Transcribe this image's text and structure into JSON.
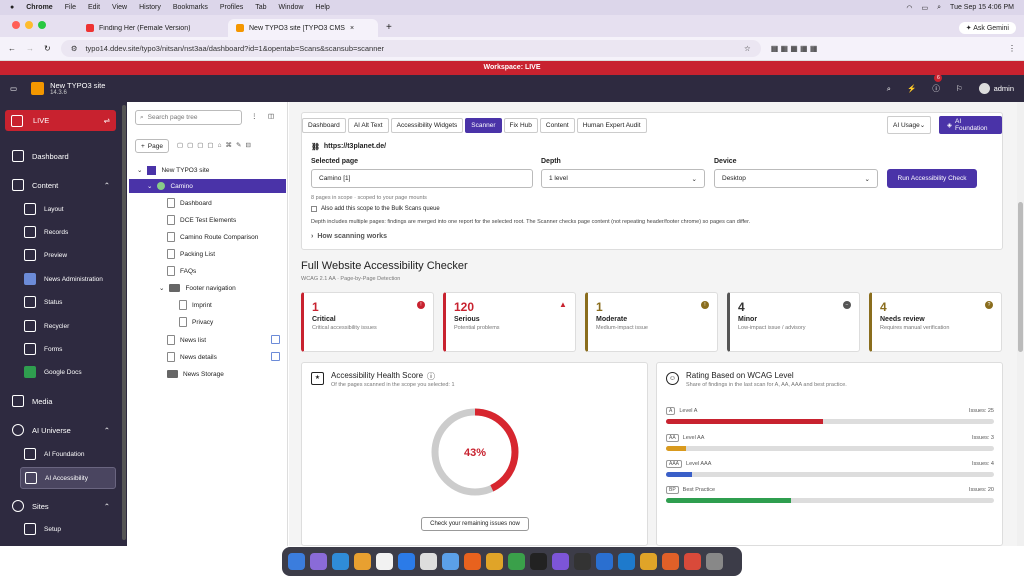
{
  "mac": {
    "app": "Chrome",
    "menus": [
      "File",
      "Edit",
      "View",
      "History",
      "Bookmarks",
      "Profiles",
      "Tab",
      "Window",
      "Help"
    ],
    "clock": "Tue Sep 15  4:06 PM"
  },
  "browser": {
    "tabs": [
      "Finding Her (Female Version)",
      "New TYPO3 site [TYPO3 CMS"
    ],
    "url": "typo14.ddev.site/typo3/nitsan/nst3aa/dashboard?id=1&opentab=Scans&scansub=scanner",
    "ask": "Ask Gemini"
  },
  "workspace": "Workspace: LIVE",
  "site": {
    "name": "New TYPO3 site",
    "version": "14.3.6",
    "user": "admin",
    "badge": "6"
  },
  "sidebar": {
    "live": "LIVE",
    "items": [
      "Dashboard",
      "Content",
      "Layout",
      "Records",
      "Preview",
      "News Administration",
      "Status",
      "Recycler",
      "Forms",
      "Google Docs",
      "Media",
      "AI Universe",
      "AI Foundation",
      "AI Accessibility",
      "Sites",
      "Setup"
    ]
  },
  "tree": {
    "search": "Search page tree",
    "new_page": "Page",
    "nodes": [
      "New TYPO3 site",
      "Camino",
      "Dashboard",
      "DCE Test Elements",
      "Camino Route Comparison",
      "Packing List",
      "FAQs",
      "Footer navigation",
      "Imprint",
      "Privacy",
      "News list",
      "News details",
      "News Storage"
    ]
  },
  "tabs": [
    "Dashboard",
    "AI Alt Text",
    "Accessibility Widgets",
    "Scanner",
    "Fix Hub",
    "Content",
    "Human Expert Audit"
  ],
  "ai_usage": "AI Usage",
  "ai_foundation": "AI Foundation",
  "scan": {
    "url": "https://t3planet.de/",
    "selected_label": "Selected page",
    "selected": "Camino [1]",
    "depth_label": "Depth",
    "depth": "1 level",
    "device_label": "Device",
    "device": "Desktop",
    "run": "Run Accessibility Check",
    "scope": "8 pages in scope · scoped to your page mounts",
    "bulk": "Also add this scope to the Bulk Scans queue",
    "depth_note": "Depth includes multiple pages: findings are merged into one report for the selected root. The Scanner checks page content (not repeating header/footer chrome) so pages can differ.",
    "how": "How scanning works"
  },
  "title": "Full Website Accessibility Checker",
  "subtitle": "WCAG 2.1 AA · Page-by-Page Detection",
  "metrics": [
    {
      "n": "1",
      "t": "Critical",
      "d": "Critical accessibility issues",
      "color": "#c8222f"
    },
    {
      "n": "120",
      "t": "Serious",
      "d": "Potential problems",
      "color": "#c8222f"
    },
    {
      "n": "1",
      "t": "Moderate",
      "d": "Medium-impact issue",
      "color": "#8a6d1d"
    },
    {
      "n": "4",
      "t": "Minor",
      "d": "Low-impact issue / advisory",
      "color": "#555"
    },
    {
      "n": "4",
      "t": "Needs review",
      "d": "Requires manual verification",
      "color": "#8a6d1d"
    }
  ],
  "health": {
    "title": "Accessibility Health Score",
    "sub": "Of the pages scanned in the scope you selected: 1",
    "score": "43%",
    "value": 43,
    "button": "Check your remaining issues now"
  },
  "rating": {
    "title": "Rating Based on WCAG Level",
    "sub": "Share of findings in the last scan for A, AA, AAA and best practice.",
    "levels": [
      {
        "badge": "A",
        "name": "Level A",
        "issues": "Issues: 25",
        "fill": 0.48,
        "color": "#c8222f"
      },
      {
        "badge": "AA",
        "name": "Level AA",
        "issues": "Issues: 3",
        "fill": 0.06,
        "color": "#d99a1e"
      },
      {
        "badge": "AAA",
        "name": "Level AAA",
        "issues": "Issues: 4",
        "fill": 0.08,
        "color": "#3a5fc8"
      },
      {
        "badge": "BP",
        "name": "Best Practice",
        "issues": "Issues: 20",
        "fill": 0.38,
        "color": "#2f9e4f"
      }
    ]
  }
}
